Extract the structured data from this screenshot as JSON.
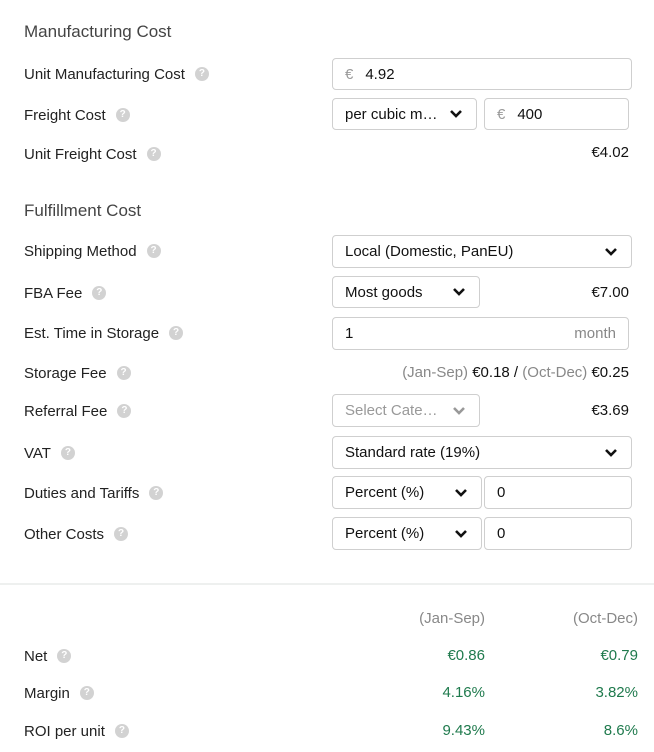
{
  "manufacturing": {
    "title": "Manufacturing Cost",
    "unit_cost": {
      "label": "Unit Manufacturing Cost",
      "currency": "€",
      "value": "4.92"
    },
    "freight": {
      "label": "Freight Cost",
      "mode": "per cubic m…",
      "currency": "€",
      "value": "400"
    },
    "unit_freight": {
      "label": "Unit Freight Cost",
      "value": "€4.02"
    }
  },
  "fulfillment": {
    "title": "Fulfillment Cost",
    "shipping_method": {
      "label": "Shipping Method",
      "value": "Local (Domestic, PanEU)"
    },
    "fba_fee": {
      "label": "FBA Fee",
      "size": "Most goods",
      "value": "€7.00"
    },
    "storage_time": {
      "label": "Est. Time in Storage",
      "value": "1",
      "suffix": "month"
    },
    "storage_fee": {
      "label": "Storage Fee",
      "period1": "(Jan-Sep)",
      "value1": "€0.18",
      "sep": " / ",
      "period2": "(Oct-Dec)",
      "value2": "€0.25"
    },
    "referral_fee": {
      "label": "Referral Fee",
      "placeholder": "Select Cate…",
      "value": "€3.69"
    },
    "vat": {
      "label": "VAT",
      "value": "Standard rate (19%)"
    },
    "duties": {
      "label": "Duties and Tariffs",
      "mode": "Percent (%)",
      "value": "0"
    },
    "other": {
      "label": "Other Costs",
      "mode": "Percent (%)",
      "value": "0"
    }
  },
  "results": {
    "columns": [
      "(Jan-Sep)",
      "(Oct-Dec)"
    ],
    "rows": [
      {
        "label": "Net",
        "values": [
          "€0.86",
          "€0.79"
        ]
      },
      {
        "label": "Margin",
        "values": [
          "4.16%",
          "3.82%"
        ]
      },
      {
        "label": "ROI per unit",
        "values": [
          "9.43%",
          "8.6%"
        ]
      }
    ],
    "value_color": "#1f7a4d"
  },
  "icons": {
    "help": "question-circle-icon",
    "chevron": "chevron-down-icon"
  }
}
